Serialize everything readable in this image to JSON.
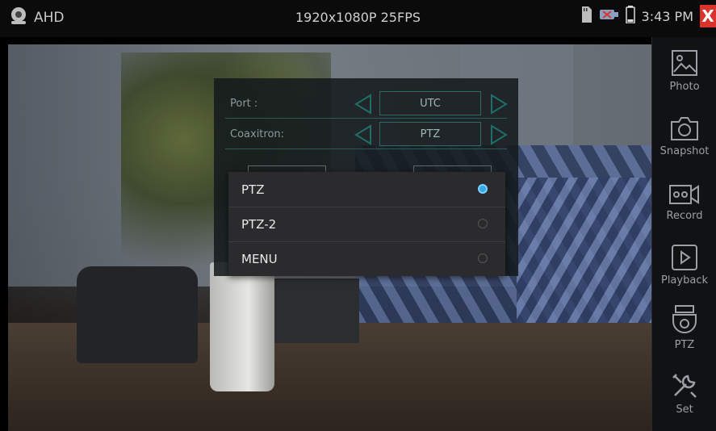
{
  "status": {
    "mode": "AHD",
    "resolution": "1920x1080P 25FPS",
    "time": "3:43 PM",
    "close_label": "X",
    "icons": [
      "camera-icon",
      "sd-card-icon",
      "usb-icon",
      "battery-icon"
    ]
  },
  "panel": {
    "rows": [
      {
        "label": "Port :",
        "value": "UTC"
      },
      {
        "label": "Coaxitron:",
        "value": "PTZ"
      }
    ]
  },
  "dropdown": {
    "options": [
      {
        "label": "PTZ",
        "selected": true
      },
      {
        "label": "PTZ-2",
        "selected": false
      },
      {
        "label": "MENU",
        "selected": false
      }
    ]
  },
  "sidebar": {
    "items": [
      {
        "label": "Photo",
        "icon": "photo-icon"
      },
      {
        "label": "Snapshot",
        "icon": "snapshot-icon"
      },
      {
        "label": "Record",
        "icon": "record-icon"
      },
      {
        "label": "Playback",
        "icon": "playback-icon"
      },
      {
        "label": "PTZ",
        "icon": "ptz-icon"
      },
      {
        "label": "Set",
        "icon": "set-icon"
      }
    ]
  },
  "colors": {
    "accent": "#35a8e6",
    "close": "#d9332b",
    "panel_border": "#2c6a64"
  }
}
